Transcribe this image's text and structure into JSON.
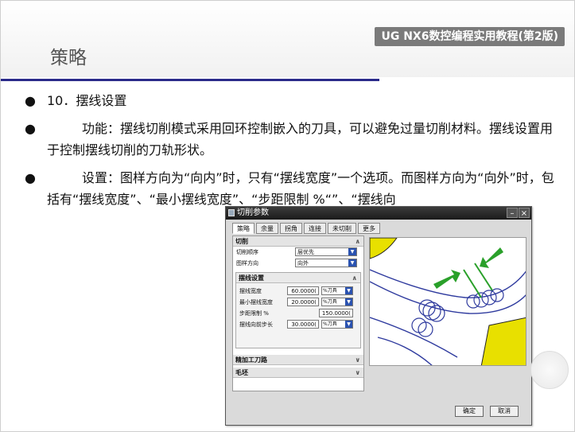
{
  "header": {
    "brand": "UG NX6数控编程实用教程(第2版)",
    "title": "策略"
  },
  "bullets": [
    {
      "text": "10．摆线设置"
    },
    {
      "text": "功能：摆线切削模式采用回环控制嵌入的刀具，可以避免过量切削材料。摆线设置用于控制摆线切削的刀轨形状。"
    },
    {
      "text": "设置：图样方向为“向内”时，只有“摆线宽度”一个选项。而图样方向为“向外”时，包括有“摆线宽度”、“最小摆线宽度”、“步距限制 %“”、“摆线向"
    }
  ],
  "dialog": {
    "title": "切削参数",
    "tabs": [
      "策略",
      "余量",
      "拐角",
      "连接",
      "未切削",
      "更多"
    ],
    "section_cut": "切削",
    "cut_order_label": "切削顺序",
    "cut_order_value": "层优先",
    "pattern_dir_label": "图样方向",
    "pattern_dir_value": "向外",
    "trochoid_section": "摆线设置",
    "trochoid_width_label": "摆线宽度",
    "trochoid_width_value": "60.0000(",
    "trochoid_width_unit": "%刀具",
    "min_trochoid_width_label": "最小摆线宽度",
    "min_trochoid_width_value": "20.0000(",
    "min_trochoid_width_unit": "%刀具",
    "stepover_limit_label": "步距限制 %",
    "stepover_limit_value": "150.0000(",
    "forward_step_label": "摆线向前步长",
    "forward_step_value": "30.0000(",
    "forward_step_unit": "%刀具",
    "section_finish": "精加工刀路",
    "section_blank": "毛坯",
    "ok_label": "确定",
    "cancel_label": "取消"
  },
  "colors": {
    "rule": "#2b2b8a",
    "brand_bg": "#7a7a7a",
    "arrow_green": "#2aa02a",
    "toolpath_blue": "#2e3a9e",
    "stock_yellow": "#e8e000"
  }
}
